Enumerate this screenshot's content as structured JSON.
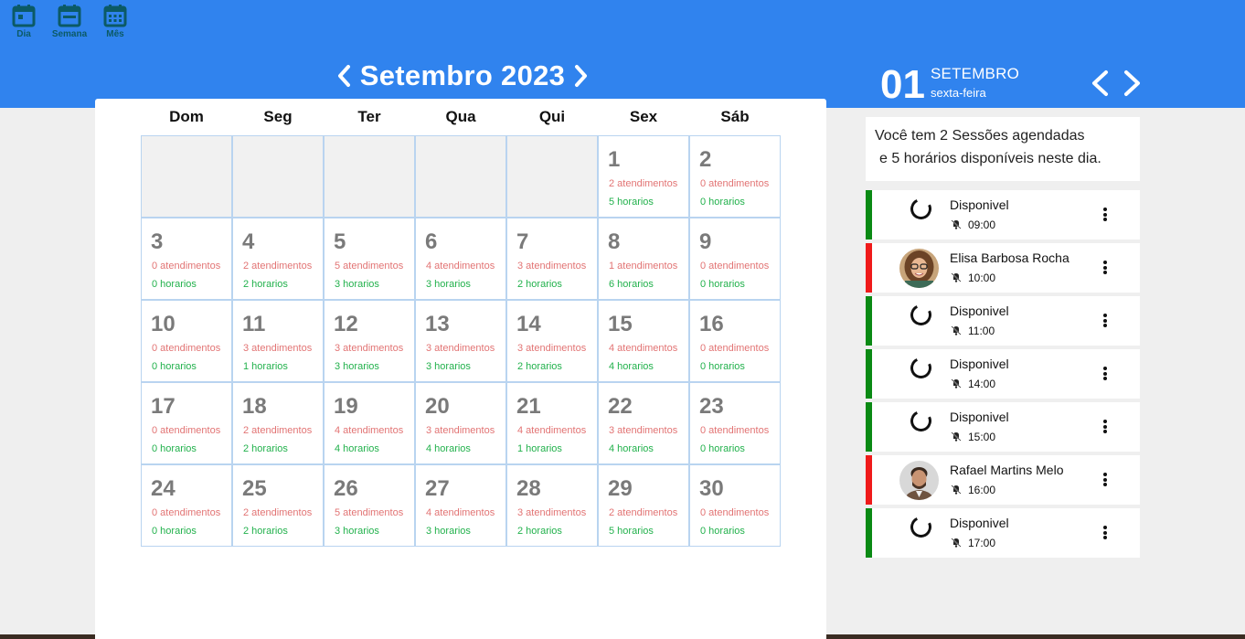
{
  "views": [
    {
      "label": "Dia",
      "icon": "calendar-day-icon"
    },
    {
      "label": "Semana",
      "icon": "calendar-week-icon"
    },
    {
      "label": "Mês",
      "icon": "calendar-month-icon"
    }
  ],
  "calendar": {
    "title": "Setembro 2023",
    "weekdays": [
      "Dom",
      "Seg",
      "Ter",
      "Qua",
      "Qui",
      "Sex",
      "Sáb"
    ],
    "leading_empty": 5,
    "days": [
      {
        "d": "1",
        "a": "2 atendimentos",
        "h": "5 horarios"
      },
      {
        "d": "2",
        "a": "0 atendimentos",
        "h": "0 horarios"
      },
      {
        "d": "3",
        "a": "0 atendimentos",
        "h": "0 horarios"
      },
      {
        "d": "4",
        "a": "2 atendimentos",
        "h": "2 horarios"
      },
      {
        "d": "5",
        "a": "5 atendimentos",
        "h": "3 horarios"
      },
      {
        "d": "6",
        "a": "4 atendimentos",
        "h": "3 horarios"
      },
      {
        "d": "7",
        "a": "3 atendimentos",
        "h": "2 horarios"
      },
      {
        "d": "8",
        "a": "1 atendimentos",
        "h": "6 horarios"
      },
      {
        "d": "9",
        "a": "0 atendimentos",
        "h": "0 horarios"
      },
      {
        "d": "10",
        "a": "0 atendimentos",
        "h": "0 horarios"
      },
      {
        "d": "11",
        "a": "3 atendimentos",
        "h": "1 horarios"
      },
      {
        "d": "12",
        "a": "3 atendimentos",
        "h": "3 horarios"
      },
      {
        "d": "13",
        "a": "3 atendimentos",
        "h": "3 horarios"
      },
      {
        "d": "14",
        "a": "3 atendimentos",
        "h": "2 horarios"
      },
      {
        "d": "15",
        "a": "4 atendimentos",
        "h": "4 horarios"
      },
      {
        "d": "16",
        "a": "0 atendimentos",
        "h": "0 horarios"
      },
      {
        "d": "17",
        "a": "0 atendimentos",
        "h": "0 horarios"
      },
      {
        "d": "18",
        "a": "2 atendimentos",
        "h": "2 horarios"
      },
      {
        "d": "19",
        "a": "4 atendimentos",
        "h": "4 horarios"
      },
      {
        "d": "20",
        "a": "3 atendimentos",
        "h": "4 horarios"
      },
      {
        "d": "21",
        "a": "4 atendimentos",
        "h": "1 horarios"
      },
      {
        "d": "22",
        "a": "3 atendimentos",
        "h": "4 horarios"
      },
      {
        "d": "23",
        "a": "0 atendimentos",
        "h": "0 horarios"
      },
      {
        "d": "24",
        "a": "0 atendimentos",
        "h": "0 horarios"
      },
      {
        "d": "25",
        "a": "2 atendimentos",
        "h": "2 horarios"
      },
      {
        "d": "26",
        "a": "5 atendimentos",
        "h": "3 horarios"
      },
      {
        "d": "27",
        "a": "4 atendimentos",
        "h": "3 horarios"
      },
      {
        "d": "28",
        "a": "3 atendimentos",
        "h": "2 horarios"
      },
      {
        "d": "29",
        "a": "2 atendimentos",
        "h": "5 horarios"
      },
      {
        "d": "30",
        "a": "0 atendimentos",
        "h": "0 horarios"
      }
    ]
  },
  "day_panel": {
    "day": "01",
    "month": "SETEMBRO",
    "weekday": "sexta-feira",
    "summary_line1": "Você tem 2 Sessões agendadas",
    "summary_line2": "e 5 horários disponíveis neste dia.",
    "slots": [
      {
        "name": "Disponivel",
        "time": "09:00",
        "status": "free"
      },
      {
        "name": "Elisa Barbosa Rocha",
        "time": "10:00",
        "status": "busy",
        "avatar": "woman"
      },
      {
        "name": "Disponivel",
        "time": "11:00",
        "status": "free"
      },
      {
        "name": "Disponivel",
        "time": "14:00",
        "status": "free"
      },
      {
        "name": "Disponivel",
        "time": "15:00",
        "status": "free"
      },
      {
        "name": "Rafael Martins Melo",
        "time": "16:00",
        "status": "busy",
        "avatar": "man"
      },
      {
        "name": "Disponivel",
        "time": "17:00",
        "status": "free"
      }
    ]
  },
  "colors": {
    "header_blue": "#3083ee",
    "free_green": "#0a8a14",
    "busy_red": "#ef1a1a",
    "atendimentos_text": "#e27474",
    "horarios_text": "#22b14c"
  }
}
